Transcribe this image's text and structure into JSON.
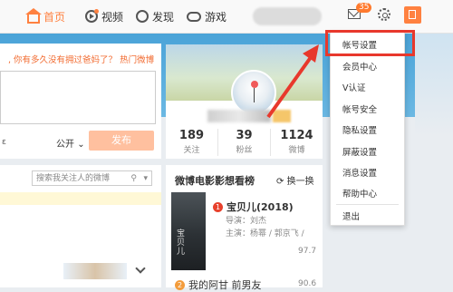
{
  "nav": {
    "home": "首页",
    "video": "视频",
    "discover": "发现",
    "games": "游戏",
    "message_count": "35"
  },
  "compose": {
    "prompt": ", 你有多久没有拥过爸妈了？",
    "hot_link": "热门微博",
    "visibility": "公开",
    "publish": "发布"
  },
  "profile": {
    "stats": [
      {
        "value": "189",
        "label": "关注"
      },
      {
        "value": "39",
        "label": "粉丝"
      },
      {
        "value": "1124",
        "label": "微博"
      }
    ]
  },
  "feed": {
    "search_placeholder": "搜索我关注人的微博"
  },
  "movies": {
    "title": "微博电影影想看榜",
    "refresh": "换一换",
    "poster_text": "宝贝儿",
    "items": [
      {
        "rank": "1",
        "name": "宝贝儿(2018)",
        "director": "导演：刘杰",
        "cast": "主演：杨幂 / 郭京飞 /",
        "score": "97.7"
      },
      {
        "rank": "2",
        "name": "我的阿甘 前男友",
        "score": "90.6"
      }
    ]
  },
  "menu": {
    "items": [
      "帐号设置",
      "会员中心",
      "V认证",
      "帐号安全",
      "隐私设置",
      "屏蔽设置",
      "消息设置",
      "帮助中心",
      "退出"
    ]
  },
  "colors": {
    "accent": "#ff8140",
    "highlight": "#e8382c",
    "banner_blue": "#4aa3d8"
  }
}
